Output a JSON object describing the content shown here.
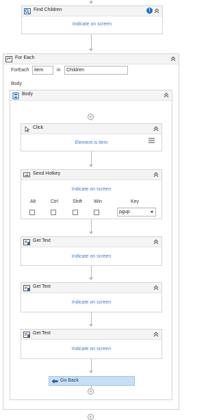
{
  "find_children": {
    "title": "Find Children",
    "link": "Indicate on screen",
    "info_icon": "info-icon",
    "collapse_icon": "double-chevron-up"
  },
  "for_each": {
    "title": "For Each",
    "foreach_label": "ForEach",
    "item_value": "item",
    "in_label": "in",
    "collection_value": "Children",
    "body_label": "Body"
  },
  "body_sequence": {
    "title": "Body"
  },
  "click": {
    "title": "Click",
    "link": "Element is item",
    "menu_icon": "hamburger-icon"
  },
  "send_hotkey": {
    "title": "Send Hotkey",
    "link": "Indicate on screen",
    "modifiers": [
      "Alt",
      "Ctrl",
      "Shift",
      "Win"
    ],
    "key_label": "Key",
    "key_value": "pgup"
  },
  "get_text_1": {
    "title": "Get Text",
    "link": "Indicate on screen"
  },
  "get_text_2": {
    "title": "Get Text",
    "link": "Indicate on screen"
  },
  "get_text_3": {
    "title": "Get Text",
    "link": "Indicate on screen"
  },
  "go_back": {
    "label": "Go Back"
  },
  "colors": {
    "link": "#3b7ec9",
    "border": "#d4d4d4",
    "header_bg": "#f4f4f4",
    "selected": "#c7e0f5",
    "info": "#1a73c8"
  }
}
